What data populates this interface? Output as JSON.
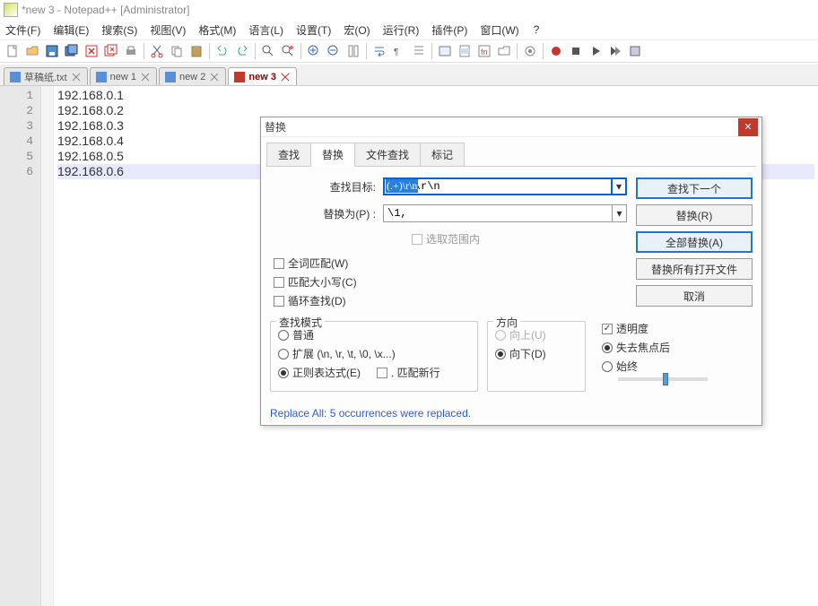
{
  "title": "*new 3 - Notepad++ [Administrator]",
  "menus": {
    "file": "文件(F)",
    "edit": "编辑(E)",
    "search": "搜索(S)",
    "view": "视图(V)",
    "format": "格式(M)",
    "language": "语言(L)",
    "settings": "设置(T)",
    "macro": "宏(O)",
    "run": "运行(R)",
    "plugin": "插件(P)",
    "window": "窗口(W)",
    "help": "?"
  },
  "tabs": [
    {
      "label": "草稿纸.txt",
      "active": false
    },
    {
      "label": "new 1",
      "active": false
    },
    {
      "label": "new 2",
      "active": false
    },
    {
      "label": "new 3",
      "active": true
    }
  ],
  "editor": {
    "lines": [
      "192.168.0.1",
      "192.168.0.2",
      "192.168.0.3",
      "192.168.0.4",
      "192.168.0.5",
      "192.168.0.6"
    ],
    "current_line_index": 5
  },
  "dialog": {
    "title": "替换",
    "tabs": {
      "find": "查找",
      "replace": "替换",
      "findfiles": "文件查找",
      "mark": "标记"
    },
    "labels": {
      "find_target": "查找目标:",
      "replace_with": "替换为(P) :",
      "in_scope": "选取范围内",
      "wholeword": "全词匹配(W)",
      "matchcase": "匹配大小写(C)",
      "wrap": "循环查找(D)",
      "mode": "查找模式",
      "normal": "普通",
      "extended": "扩展 (\\n, \\r, \\t, \\0, \\x...)",
      "regex": "正则表达式(E)",
      "dotnl": ". 匹配新行",
      "direction": "方向",
      "up": "向上(U)",
      "down": "向下(D)",
      "transparency": "透明度",
      "onblur": "失去焦点后",
      "always": "始终"
    },
    "values": {
      "find": "(.+)\\r\\n",
      "replace": "\\1,"
    },
    "buttons": {
      "findnext": "查找下一个",
      "replace": "替换(R)",
      "replaceall": "全部替换(A)",
      "replaceall_open": "替换所有打开文件",
      "cancel": "取消"
    },
    "status": "Replace All: 5 occurrences were replaced."
  }
}
